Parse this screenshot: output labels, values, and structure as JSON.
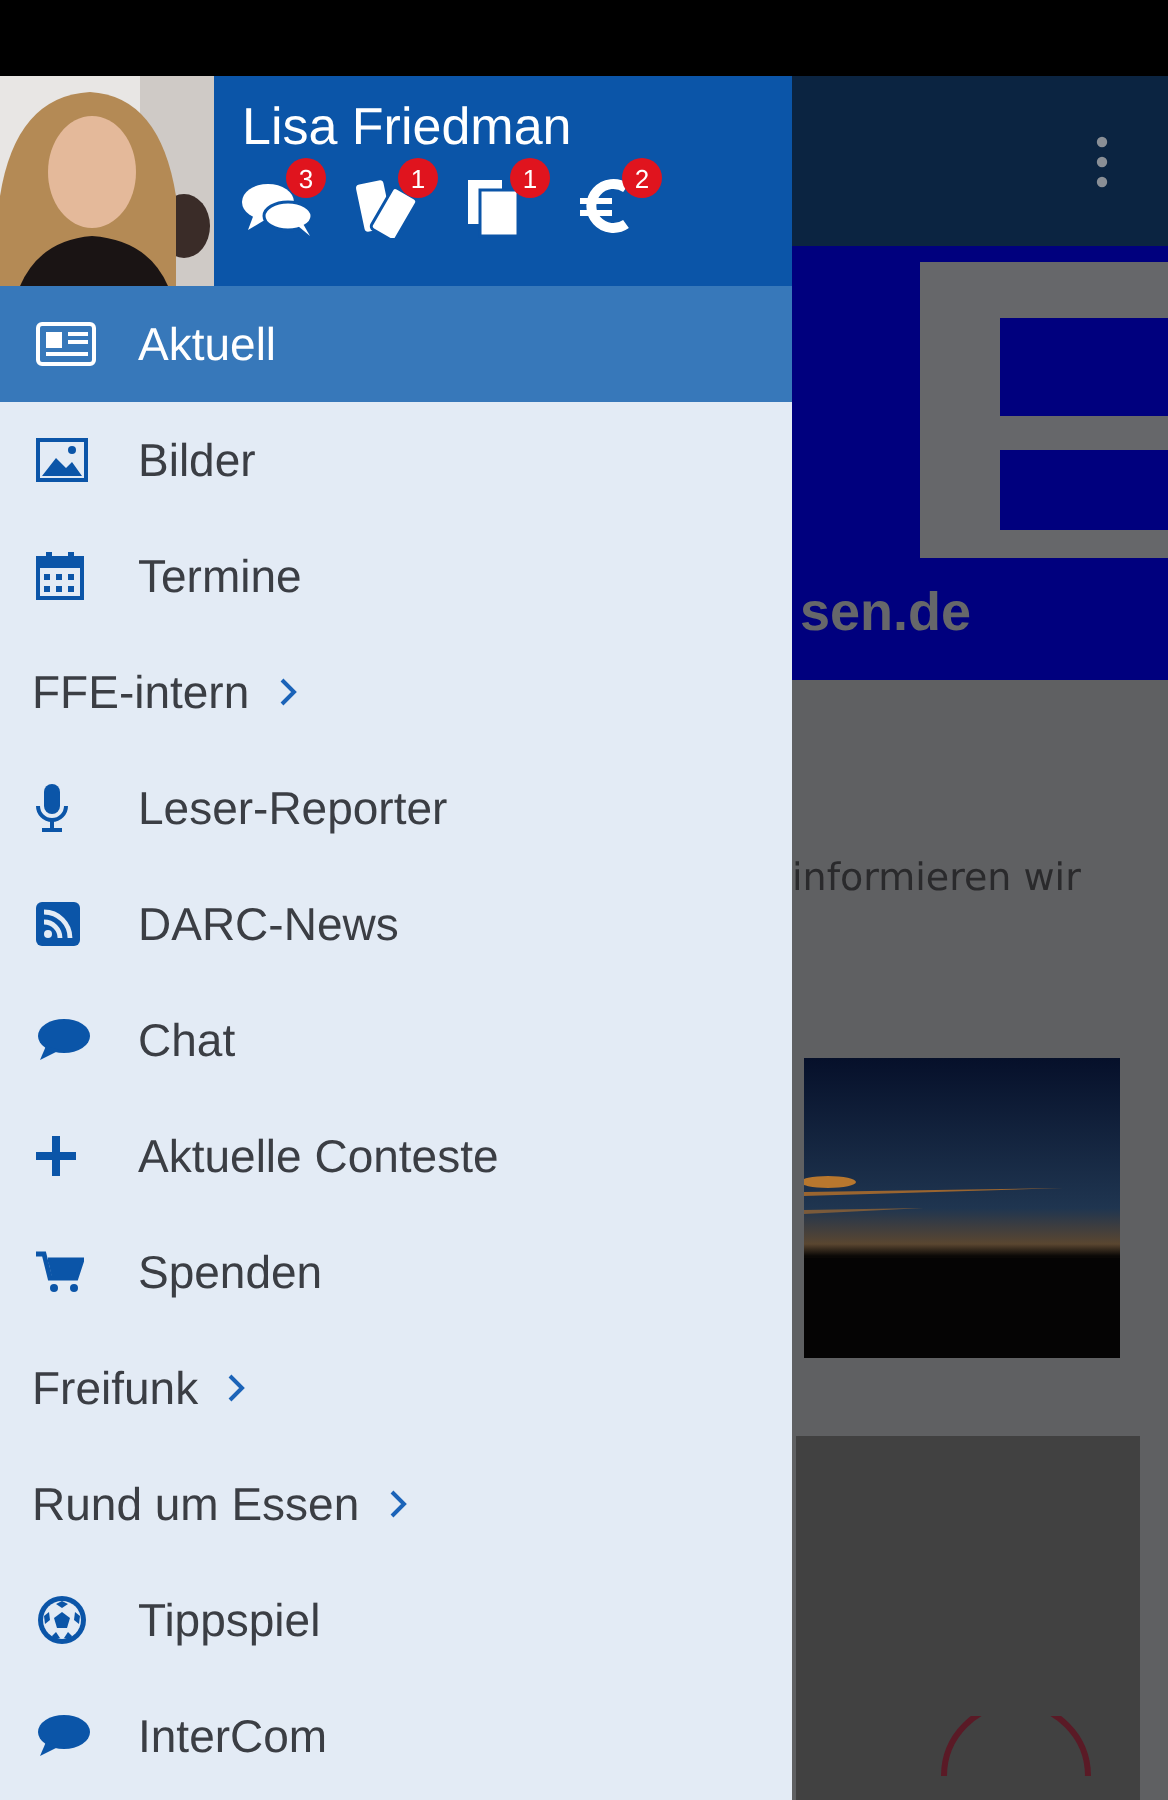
{
  "drawer": {
    "user": {
      "name": "Lisa Friedman"
    },
    "badges": [
      {
        "count": "3"
      },
      {
        "count": "1"
      },
      {
        "count": "1"
      },
      {
        "count": "2"
      }
    ],
    "items": [
      {
        "kind": "item",
        "label": "Aktuell",
        "selected": true
      },
      {
        "kind": "item",
        "label": "Bilder",
        "selected": false
      },
      {
        "kind": "item",
        "label": "Termine",
        "selected": false
      },
      {
        "kind": "section",
        "label": "FFE-intern",
        "selected": false
      },
      {
        "kind": "item",
        "label": "Leser-Reporter",
        "selected": false
      },
      {
        "kind": "item",
        "label": "DARC-News",
        "selected": false
      },
      {
        "kind": "item",
        "label": "Chat",
        "selected": false
      },
      {
        "kind": "item",
        "label": "Aktuelle Conteste",
        "selected": false
      },
      {
        "kind": "item",
        "label": "Spenden",
        "selected": false
      },
      {
        "kind": "section",
        "label": "Freifunk",
        "selected": false
      },
      {
        "kind": "section",
        "label": "Rund um Essen",
        "selected": false
      },
      {
        "kind": "item",
        "label": "Tippspiel",
        "selected": false
      },
      {
        "kind": "item",
        "label": "InterCom",
        "selected": false
      }
    ]
  },
  "background": {
    "banner_text": "sen.de",
    "body_text": "informieren wir"
  }
}
